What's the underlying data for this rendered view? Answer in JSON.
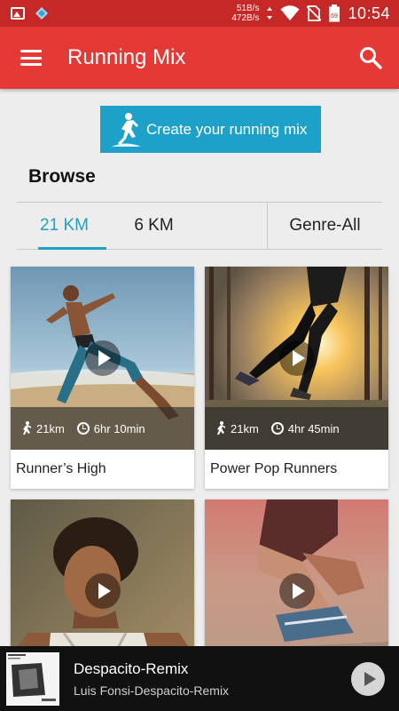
{
  "status_bar": {
    "net_up": "51B/s",
    "net_down": "472B/s",
    "battery": "69",
    "time": "10:54"
  },
  "app_bar": {
    "title": "Running Mix",
    "menu_icon": "hamburger-menu-icon",
    "search_icon": "search-icon"
  },
  "create_button": {
    "label": "Create your running mix",
    "icon": "runner-icon"
  },
  "browse": {
    "title": "Browse",
    "tabs": [
      {
        "label": "21 KM",
        "selected": true
      },
      {
        "label": "6 KM",
        "selected": false
      }
    ],
    "genre_filter": "Genre-All"
  },
  "cards": [
    {
      "title": "Runner’s High",
      "distance": "21km",
      "duration": "6hr 10min"
    },
    {
      "title": "Power Pop Runners",
      "distance": "21km",
      "duration": "4hr 45min"
    },
    {
      "title": "",
      "distance": "",
      "duration": ""
    },
    {
      "title": "",
      "distance": "",
      "duration": ""
    }
  ],
  "player": {
    "track_title": "Despacito-Remix",
    "track_artist": "Luis Fonsi-Despacito-Remix"
  },
  "colors": {
    "status_bar": "#c62828",
    "app_bar": "#e53935",
    "accent": "#1ea1c9",
    "player_bg": "#111111"
  }
}
